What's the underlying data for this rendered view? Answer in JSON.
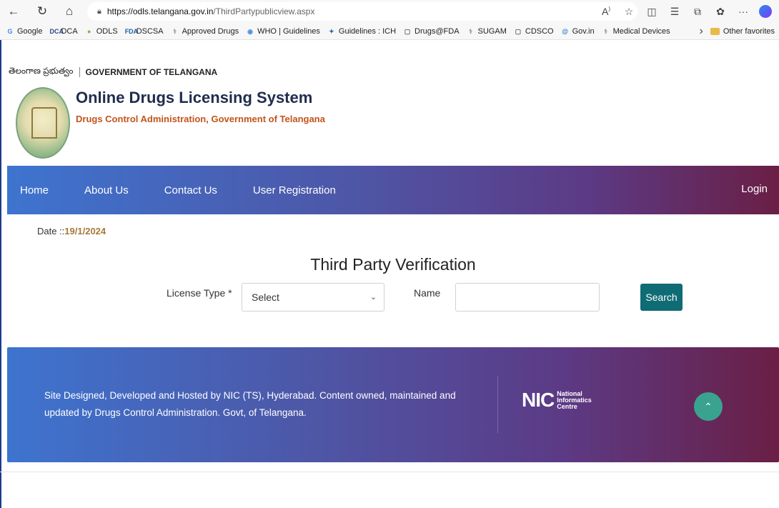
{
  "browser": {
    "url_host": "https://odls.telangana.gov.in",
    "url_path": "/ThirdPartypublicview.aspx",
    "icons": [
      "back-icon",
      "refresh-icon",
      "home-icon",
      "lock-icon",
      "read-aloud-icon",
      "favorite-star-icon",
      "split-screen-icon",
      "favorites-icon",
      "collections-icon",
      "extensions-icon",
      "more-icon",
      "copilot-icon"
    ]
  },
  "favorites": {
    "items": [
      {
        "icon": "G",
        "label": "Google",
        "color": "#4285f4"
      },
      {
        "icon": "DCA",
        "label": "DCA",
        "color": "#2b4a8a"
      },
      {
        "icon": "●",
        "label": "ODLS",
        "color": "#7ab648"
      },
      {
        "icon": "FDA",
        "label": "DSCSA",
        "color": "#1f5fa8"
      },
      {
        "icon": "⚕",
        "label": "Approved Drugs",
        "color": "#999999"
      },
      {
        "icon": "◉",
        "label": "WHO | Guidelines",
        "color": "#4a90d9"
      },
      {
        "icon": "✦",
        "label": "Guidelines : ICH",
        "color": "#1f6fb5"
      },
      {
        "icon": "▢",
        "label": "Drugs@FDA",
        "color": "#666666"
      },
      {
        "icon": "⚕",
        "label": "SUGAM",
        "color": "#999999"
      },
      {
        "icon": "▢",
        "label": "CDSCO",
        "color": "#666666"
      },
      {
        "icon": "@",
        "label": "Gov.in",
        "color": "#2a7fd4"
      },
      {
        "icon": "⚕",
        "label": "Medical Devices",
        "color": "#999999"
      }
    ],
    "other": "Other favorites"
  },
  "header": {
    "telugu": "తెలంగాణ ప్రభుత్వం",
    "gov": "GOVERNMENT OF TELANGANA",
    "title": "Online Drugs Licensing System",
    "subtitle": "Drugs Control Administration, Government of Telangana"
  },
  "nav": {
    "items": [
      "Home",
      "About Us",
      "Contact Us",
      "User Registration"
    ],
    "login": "Login"
  },
  "main": {
    "date_label": "Date ::",
    "date_value": "19/1/2024",
    "title": "Third Party Verification",
    "license_label": "License Type *",
    "license_value": "Select",
    "name_label": "Name",
    "name_value": "",
    "search_label": "Search"
  },
  "footer": {
    "text": "Site Designed, Developed and Hosted by NIC (TS), Hyderabad. Content owned, maintained and updated by Drugs Control Administration. Govt, of Telangana.",
    "nic_mark": "NIC",
    "nic_line1": "National",
    "nic_line2": "Informatics",
    "nic_line3": "Centre"
  },
  "colors": {
    "nav_start": "#3e74cf",
    "nav_end": "#6a1f45",
    "search_button": "#0f6b74",
    "scroll_top_button": "#3aa38f",
    "date_value": "#a47a3a",
    "subtitle": "#c2541a"
  }
}
